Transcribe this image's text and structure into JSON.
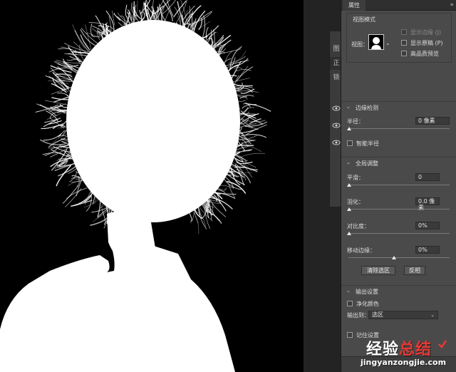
{
  "properties_panel": {
    "tab_label": "属性",
    "collapse_glyph": "»",
    "view_mode": {
      "title": "视图模式",
      "view_label": "视图：",
      "dropdown_glyph": "⌄",
      "options": [
        {
          "label": "显示边缘 (J)",
          "checked": false,
          "disabled": true
        },
        {
          "label": "显示原稿 (P)",
          "checked": false,
          "disabled": false
        },
        {
          "label": "高品质预览",
          "checked": false,
          "disabled": false
        }
      ]
    },
    "edge_detection": {
      "title": "边缘检测",
      "radius_label": "半径：",
      "radius_value": "0 像素",
      "radius_fraction": 0.0,
      "smart_radius_label": "智能半径",
      "smart_radius_checked": false
    },
    "global_refinements": {
      "title": "全局调整",
      "smooth_label": "平滑：",
      "smooth_value": "0",
      "smooth_fraction": 0.0,
      "feather_label": "羽化：",
      "feather_value": "0.0 像素",
      "feather_fraction": 0.0,
      "contrast_label": "对比度：",
      "contrast_value": "0%",
      "contrast_fraction": 0.0,
      "shift_edge_label": "移动边缘：",
      "shift_edge_value": "0%",
      "shift_edge_fraction": 0.5,
      "clear_selection_label": "清除选区",
      "invert_label": "反相"
    },
    "output_settings": {
      "title": "输出设置",
      "decontaminate_label": "净化颜色",
      "decontaminate_checked": false,
      "output_to_label": "输出到：",
      "output_to_value": "选区",
      "remember_label": "记住设置",
      "remember_checked": false
    }
  },
  "layers_panel": {
    "partial_tab": "图",
    "partial_mode": "正",
    "partial_lock": "锁"
  },
  "watermark": {
    "main_white": "经验",
    "main_red": "总结",
    "url": "jingyanzongjie.com"
  },
  "colors": {
    "panel_bg": "#4a4a4a",
    "panel_dark": "#2f2f2f",
    "canvas_bg": "#000000",
    "mask_white": "#ffffff",
    "watermark_red": "#e53935"
  }
}
